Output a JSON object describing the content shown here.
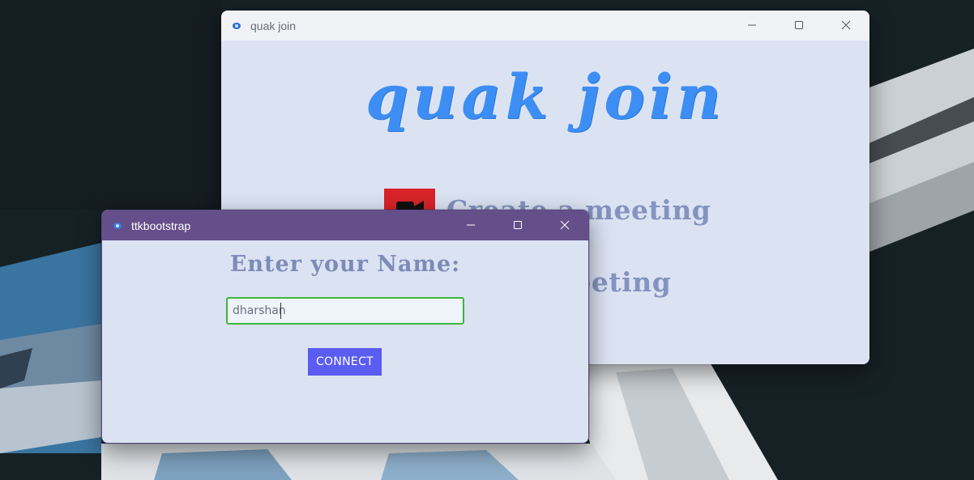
{
  "desktop": {
    "wallpaper_icon": "jet-wallpaper"
  },
  "main_window": {
    "title": "quak join",
    "app_icon": "app-logo-icon",
    "heading": "quak join",
    "menu": [
      {
        "label": "Create a meeting",
        "icon": "video-camera-icon",
        "icon_color": "#d8232a"
      },
      {
        "label": "Join a meeting",
        "icon": ""
      }
    ],
    "controls": [
      "minimize-icon",
      "maximize-icon",
      "close-icon"
    ]
  },
  "dialog": {
    "title": "ttkbootstrap",
    "app_icon": "app-logo-icon",
    "prompt": "Enter your Name:",
    "name_input": {
      "value": "dharshan",
      "placeholder": ""
    },
    "connect_label": "CONNECT",
    "controls": [
      "minimize-icon",
      "maximize-icon",
      "close-icon"
    ]
  },
  "colors": {
    "brand": "#3d8ef4",
    "menu_text": "#8493bf",
    "dialog_titlebar": "#654f8a",
    "button": "#5b5cf1",
    "input_border": "#3cb73c",
    "window_bg": "#dbe3f3"
  }
}
